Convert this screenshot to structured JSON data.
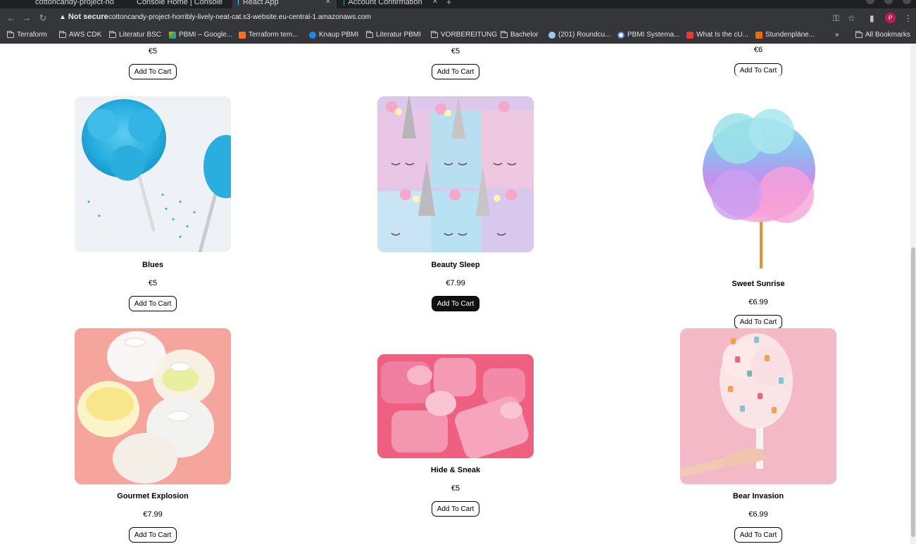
{
  "browser": {
    "tabs": [
      {
        "title": "cottoncandy-project-ho",
        "favicon_color": "#2e7d32",
        "active": false
      },
      {
        "title": "Console Home | Console",
        "favicon_color": "#ff9900",
        "active": false
      },
      {
        "title": "React App",
        "favicon_color": "#61dafb",
        "active": true
      },
      {
        "title": "Account Confirmation",
        "favicon_color": "#34a853",
        "active": false
      }
    ],
    "security_label": "Not secure",
    "url": "cottoncandy-project-horribly-lively-neat-cat.s3-website.eu-central-1.amazonaws.com",
    "profile_initial": "P",
    "bookmarks": [
      {
        "label": "Terraform",
        "icon": "folder-icon"
      },
      {
        "label": "AWS CDK",
        "icon": "folder-icon"
      },
      {
        "label": "Literatur BSC",
        "icon": "folder-icon"
      },
      {
        "label": "PBMI – Google...",
        "icon": "google-drive-icon"
      },
      {
        "label": "Terraform tem...",
        "icon": "gitlab-icon"
      },
      {
        "label": "Knaup PBMI",
        "icon": "site-icon"
      },
      {
        "label": "Literatur PBMI",
        "icon": "folder-icon"
      },
      {
        "label": "VORBEREITUNG",
        "icon": "folder-icon"
      },
      {
        "label": "Bachelor",
        "icon": "folder-icon"
      },
      {
        "label": "(201) Roundcu...",
        "icon": "site-icon"
      },
      {
        "label": "PBMI Systema...",
        "icon": "google-icon"
      },
      {
        "label": "What Is the cU...",
        "icon": "site-icon"
      },
      {
        "label": "Stundenpläne...",
        "icon": "site-icon"
      },
      {
        "label": "All Bookmarks",
        "icon": "folder-icon"
      }
    ],
    "overflow_label": "»"
  },
  "products_partial": [
    {
      "price": "€5",
      "button": "Add To Cart"
    },
    {
      "price": "€5",
      "button": "Add To Cart"
    },
    {
      "price": "€6",
      "button": "Add To Cart"
    }
  ],
  "products": [
    {
      "name": "Blues",
      "price": "€5",
      "button": "Add To Cart",
      "image": "blue-cotton-candy"
    },
    {
      "name": "Beauty Sleep",
      "price": "€7.99",
      "button": "Add To Cart",
      "image": "unicorn-cups",
      "button_state": "hover"
    },
    {
      "name": "Sweet Sunrise",
      "price": "€6.99",
      "button": "Add To Cart",
      "image": "rainbow-cotton-candy"
    },
    {
      "name": "Gourmet Explosion",
      "price": "€7.99",
      "button": "Add To Cart",
      "image": "cotton-candy-domes"
    },
    {
      "name": "Hide & Sneak",
      "price": "€5",
      "button": "Add To Cart",
      "image": "pink-cups"
    },
    {
      "name": "Bear Invasion",
      "price": "€6.99",
      "button": "Add To Cart",
      "image": "gummy-bear-cotton-candy"
    }
  ],
  "colors": {
    "chrome_dark": "#35363a",
    "tab_strip": "#1f2023",
    "button_active": "#111111"
  }
}
